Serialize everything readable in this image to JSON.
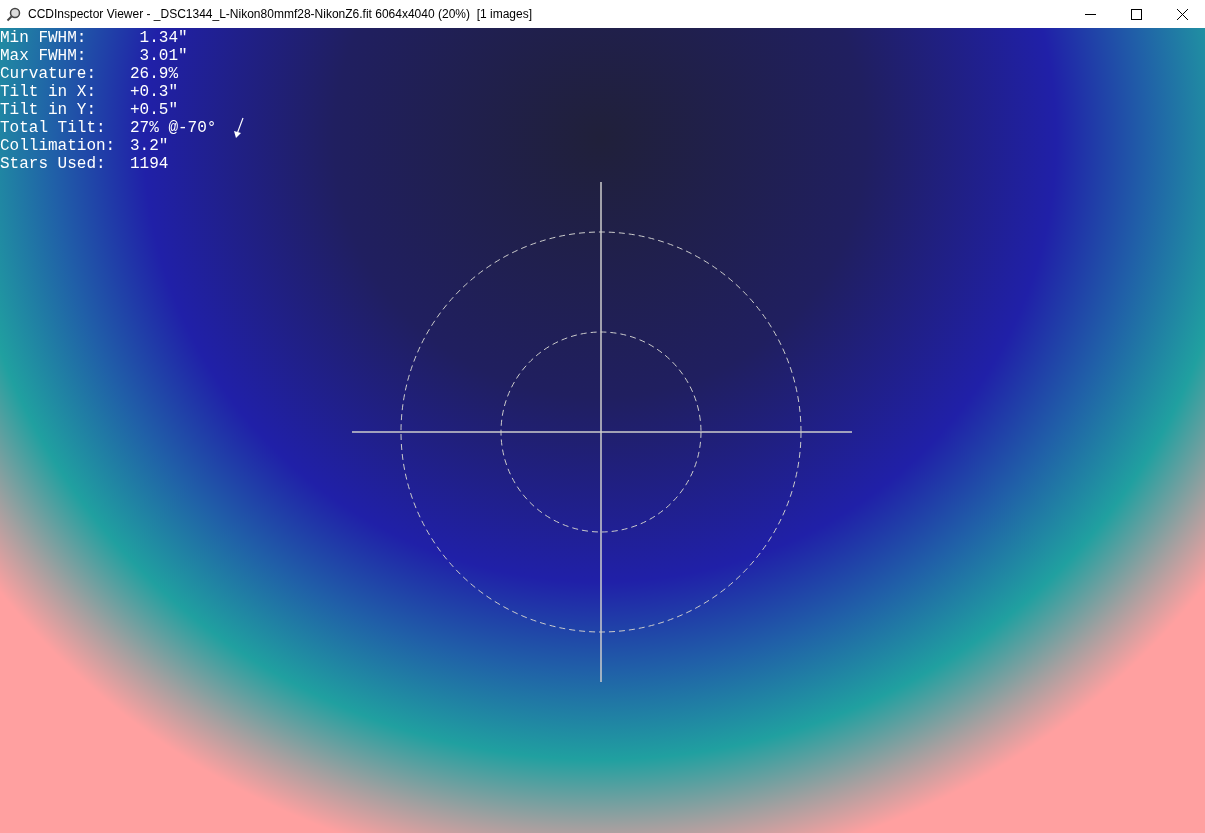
{
  "window": {
    "title": "CCDInspector Viewer - _DSC1344_L-Nikon80mmf28-NikonZ6.fit 6064x4040 (20%)  [1 images]"
  },
  "stats": [
    {
      "label": "Min FWHM:",
      "value": " 1.34\""
    },
    {
      "label": "Max FWHM:",
      "value": " 3.01\""
    },
    {
      "label": "Curvature:",
      "value": "26.9%"
    },
    {
      "label": "Tilt in X:",
      "value": "+0.3\""
    },
    {
      "label": "Tilt in Y:",
      "value": "+0.5\""
    },
    {
      "label": "Total Tilt:",
      "value": "27% @-70°"
    },
    {
      "label": "Collimation:",
      "value": "3.2\""
    },
    {
      "label": "Stars Used:",
      "value": "1194"
    }
  ]
}
